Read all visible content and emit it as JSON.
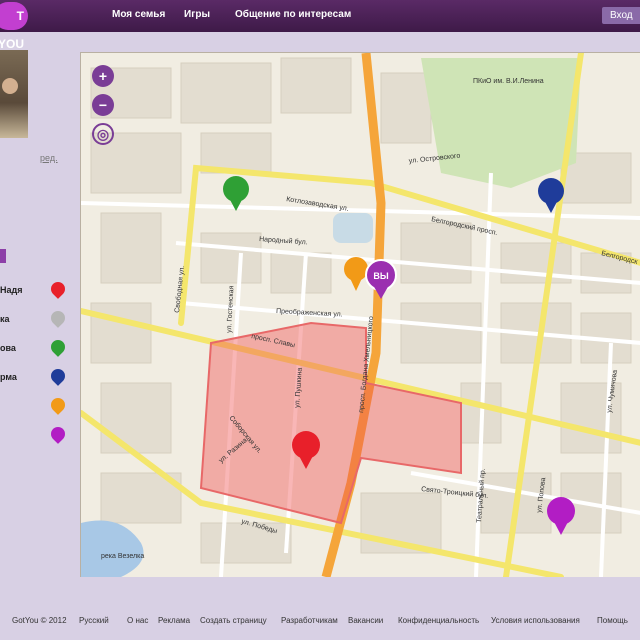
{
  "header": {
    "logo_text": "T YOU",
    "nav": [
      "Моя семья",
      "Игры",
      "Общение по интересам"
    ],
    "login_label": "Вход"
  },
  "sidebar": {
    "edit_label": "ред.",
    "members": [
      {
        "name": "Надя",
        "color": "#e8202a"
      },
      {
        "name": "ка",
        "color": "#b6b6b6"
      },
      {
        "name": "ова",
        "color": "#2fa035"
      },
      {
        "name": "рма",
        "color": "#1f3c9a"
      },
      {
        "name": "",
        "color": "#f29a17"
      },
      {
        "name": "",
        "color": "#b21dc4"
      }
    ]
  },
  "map": {
    "you_label": "ВЫ",
    "streets": [
      "Котлозаводская ул.",
      "Белгородский просп.",
      "Свободная ул.",
      "Народный бул.",
      "Преображенская ул.",
      "просп. Славы",
      "просп. Богдана Хмельницкого",
      "ул. Гостенская",
      "ул. Пушкина",
      "Соборская ул.",
      "ул. Разина",
      "Свято-Троицкий бул.",
      "ул. Попова",
      "ул. Островского",
      "ул. Победы",
      "Театральный пр.",
      "ул. Чумичова",
      "ПКиО им. В.И.Ленина",
      "река Везелка",
      "Белгородск"
    ]
  },
  "footer": {
    "copyright": "GotYou © 2012",
    "language": "Русский",
    "links": [
      "О нас",
      "Реклама",
      "Создать страницу",
      "Разработчикам",
      "Вакансии",
      "Конфиденциальность",
      "Условия использования",
      "Помощь"
    ]
  }
}
